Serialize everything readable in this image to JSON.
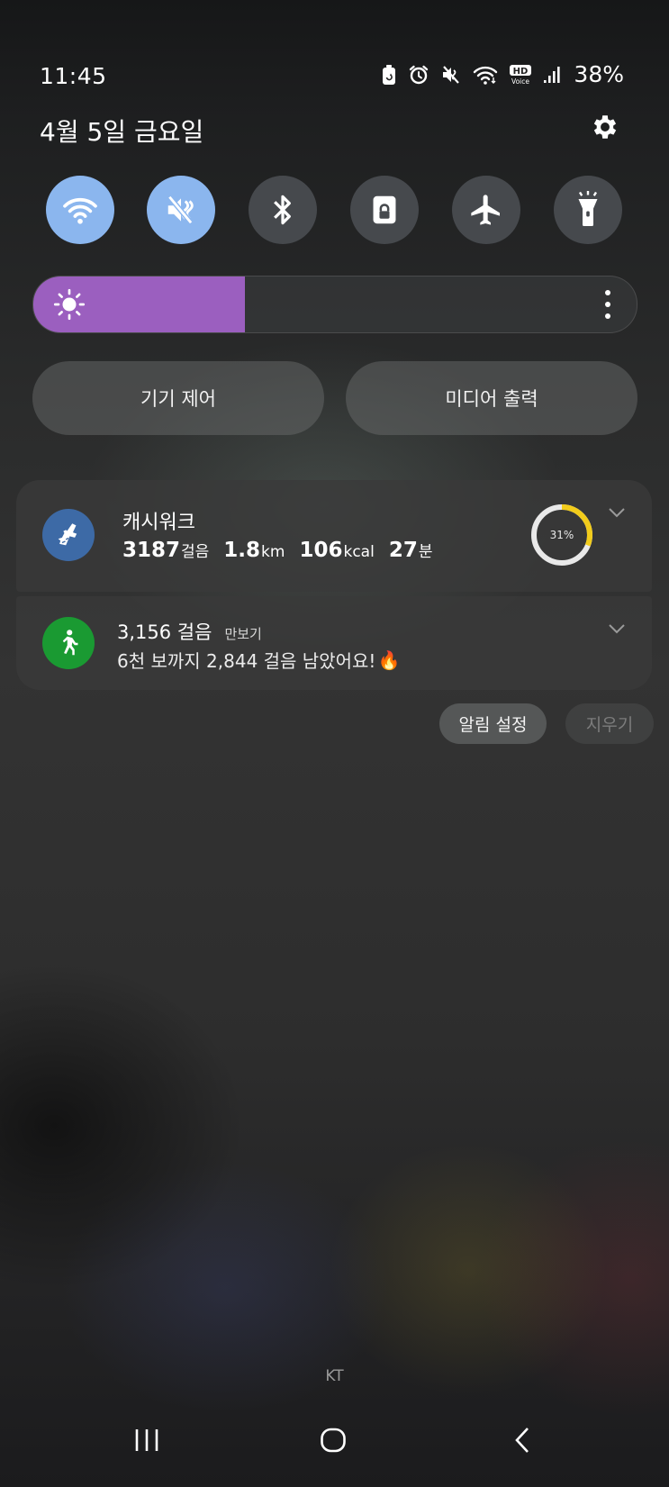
{
  "status_bar": {
    "time": "11:45",
    "battery_percent": "38%",
    "icons": [
      "battery-saver-icon",
      "alarm-icon",
      "mute-icon",
      "wifi-icon",
      "hd-voice-icon",
      "signal-icon"
    ],
    "hd_voice_top": "HD",
    "hd_voice_bottom": "Voice"
  },
  "header": {
    "date": "4월 5일 금요일"
  },
  "quick_toggles": [
    {
      "name": "wifi",
      "icon": "wifi-icon",
      "on": true
    },
    {
      "name": "sound",
      "icon": "mute-icon",
      "on": true
    },
    {
      "name": "bluetooth",
      "icon": "bluetooth-icon",
      "on": false
    },
    {
      "name": "rotation-lock",
      "icon": "lock-icon",
      "on": false
    },
    {
      "name": "airplane",
      "icon": "airplane-icon",
      "on": false
    },
    {
      "name": "flashlight",
      "icon": "flashlight-icon",
      "on": false
    }
  ],
  "brightness": {
    "level_percent": 35,
    "color": "#9b5fbf"
  },
  "panel_buttons": {
    "device_control": "기기 제어",
    "media_output": "미디어 출력"
  },
  "notifications": {
    "cashwalk": {
      "app": "캐시워크",
      "steps": "3187",
      "steps_unit": "걸음",
      "distance": "1.8",
      "distance_unit": "km",
      "calories": "106",
      "calories_unit": "kcal",
      "minutes": "27",
      "minutes_unit": "분",
      "progress_label": "31%",
      "progress_percent": 31,
      "icon_color": "#3d6aa6"
    },
    "pedometer": {
      "steps": "3,156 걸음",
      "app": "만보기",
      "message": "6천 보까지 2,844 걸음 남았어요!",
      "emoji": "🔥",
      "icon_color": "#1a9a32"
    }
  },
  "actions": {
    "notification_settings": "알림 설정",
    "clear": "지우기"
  },
  "carrier": "KT",
  "nav": {
    "recent": "recent-apps-icon",
    "home": "home-icon",
    "back": "back-icon"
  }
}
